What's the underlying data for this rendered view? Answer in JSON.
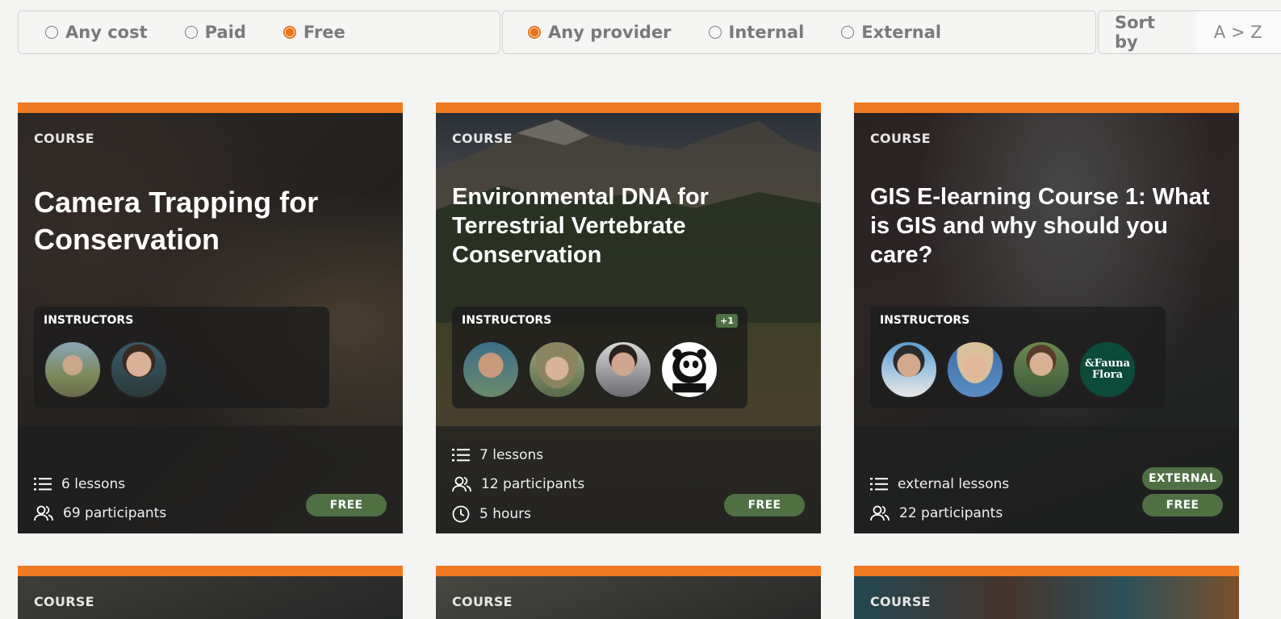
{
  "filters": {
    "cost": {
      "options": [
        {
          "label": "Any cost",
          "selected": false
        },
        {
          "label": "Paid",
          "selected": false
        },
        {
          "label": "Free",
          "selected": true
        }
      ]
    },
    "provider": {
      "options": [
        {
          "label": "Any provider",
          "selected": true
        },
        {
          "label": "Internal",
          "selected": false
        },
        {
          "label": "External",
          "selected": false
        }
      ]
    },
    "sort": {
      "label": "Sort by",
      "value": "A > Z"
    }
  },
  "accent_color": "#ee7a22",
  "badge_color": "#4e7043",
  "cards": [
    {
      "kind": "COURSE",
      "title": "Camera Trapping for Conservation",
      "instructors_label": "INSTRUCTORS",
      "instructor_count": 2,
      "lessons": "6 lessons",
      "participants": "69 participants",
      "badges": [
        "FREE"
      ]
    },
    {
      "kind": "COURSE",
      "title": "Environmental DNA for Terrestrial Vertebrate Conservation",
      "instructors_label": "INSTRUCTORS",
      "more_instructors": "+1",
      "instructor_count": 4,
      "lessons": "7 lessons",
      "participants": "12 participants",
      "duration": "5 hours",
      "badges": [
        "FREE"
      ]
    },
    {
      "kind": "COURSE",
      "title": "GIS E-learning Course 1: What is GIS and why should you care?",
      "instructors_label": "INSTRUCTORS",
      "instructor_count": 4,
      "partner_logo_text": [
        "&Fauna",
        "Flora"
      ],
      "lessons": "external lessons",
      "participants": "22 participants",
      "badges": [
        "EXTERNAL",
        "FREE"
      ]
    },
    {
      "kind": "COURSE"
    },
    {
      "kind": "COURSE"
    },
    {
      "kind": "COURSE"
    }
  ]
}
